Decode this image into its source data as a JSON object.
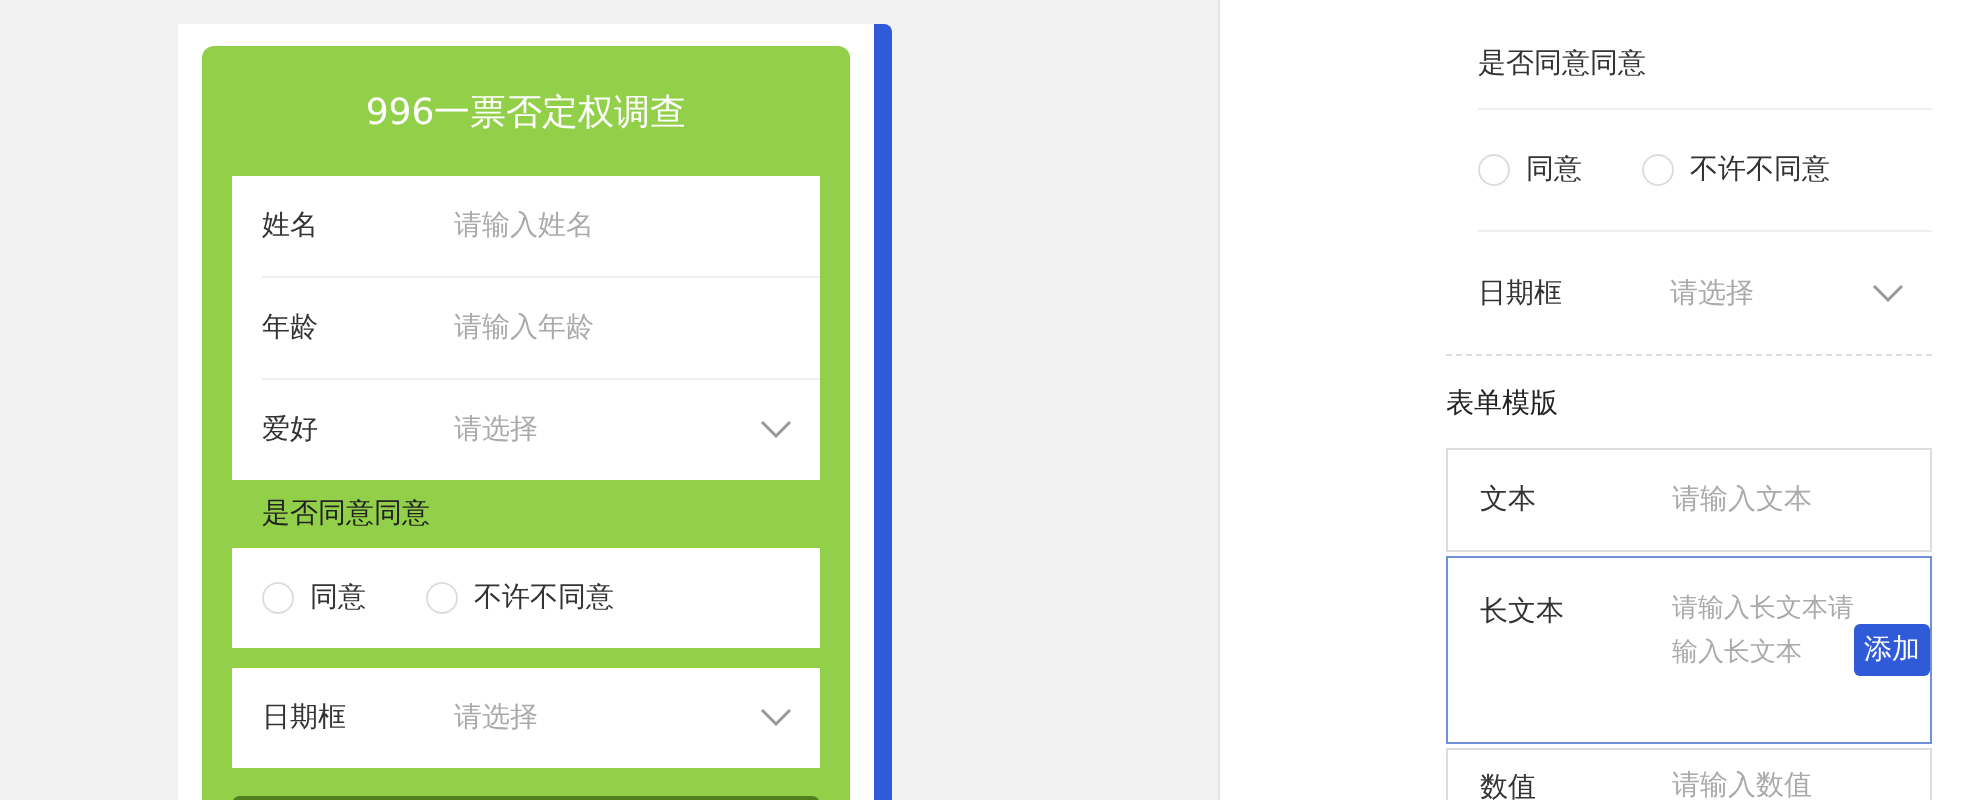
{
  "survey": {
    "title": "996一票否定权调查",
    "fields": [
      {
        "kind": "text",
        "label": "姓名",
        "placeholder": "请输入姓名"
      },
      {
        "kind": "text",
        "label": "年龄",
        "placeholder": "请输入年龄"
      },
      {
        "kind": "select",
        "label": "爱好",
        "placeholder": "请选择"
      }
    ],
    "question": {
      "label": "是否同意同意",
      "options": [
        {
          "label": "同意",
          "selected": false
        },
        {
          "label": "不许不同意",
          "selected": false
        }
      ]
    },
    "date_field": {
      "label": "日期框",
      "placeholder": "请选择"
    }
  },
  "preview": {
    "question": {
      "label": "是否同意同意",
      "options": [
        {
          "label": "同意",
          "selected": false
        },
        {
          "label": "不许不同意",
          "selected": false
        }
      ]
    },
    "date_field": {
      "label": "日期框",
      "placeholder": "请选择"
    }
  },
  "templates": {
    "title": "表单模版",
    "items": [
      {
        "kind": "text",
        "label": "文本",
        "placeholder": "请输入文本",
        "selected": false
      },
      {
        "kind": "textarea",
        "label": "长文本",
        "placeholder": "请输入长文本请输入长文本",
        "selected": true,
        "action": "添加"
      },
      {
        "kind": "text",
        "label": "数值",
        "placeholder": "请输入数值",
        "selected": false
      }
    ]
  }
}
